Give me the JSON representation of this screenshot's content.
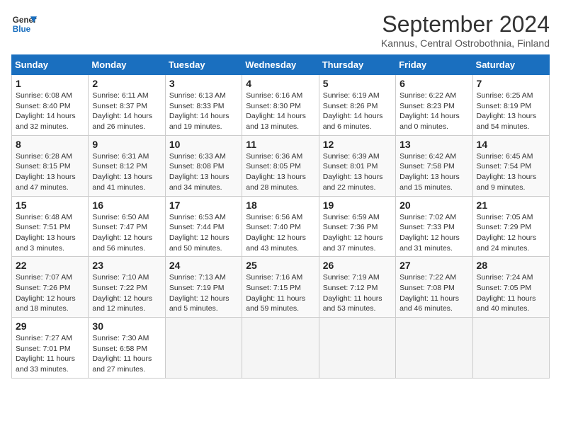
{
  "header": {
    "logo_line1": "General",
    "logo_line2": "Blue",
    "month_title": "September 2024",
    "subtitle": "Kannus, Central Ostrobothnia, Finland"
  },
  "weekdays": [
    "Sunday",
    "Monday",
    "Tuesday",
    "Wednesday",
    "Thursday",
    "Friday",
    "Saturday"
  ],
  "weeks": [
    [
      {
        "day": "1",
        "info": "Sunrise: 6:08 AM\nSunset: 8:40 PM\nDaylight: 14 hours\nand 32 minutes."
      },
      {
        "day": "2",
        "info": "Sunrise: 6:11 AM\nSunset: 8:37 PM\nDaylight: 14 hours\nand 26 minutes."
      },
      {
        "day": "3",
        "info": "Sunrise: 6:13 AM\nSunset: 8:33 PM\nDaylight: 14 hours\nand 19 minutes."
      },
      {
        "day": "4",
        "info": "Sunrise: 6:16 AM\nSunset: 8:30 PM\nDaylight: 14 hours\nand 13 minutes."
      },
      {
        "day": "5",
        "info": "Sunrise: 6:19 AM\nSunset: 8:26 PM\nDaylight: 14 hours\nand 6 minutes."
      },
      {
        "day": "6",
        "info": "Sunrise: 6:22 AM\nSunset: 8:23 PM\nDaylight: 14 hours\nand 0 minutes."
      },
      {
        "day": "7",
        "info": "Sunrise: 6:25 AM\nSunset: 8:19 PM\nDaylight: 13 hours\nand 54 minutes."
      }
    ],
    [
      {
        "day": "8",
        "info": "Sunrise: 6:28 AM\nSunset: 8:15 PM\nDaylight: 13 hours\nand 47 minutes."
      },
      {
        "day": "9",
        "info": "Sunrise: 6:31 AM\nSunset: 8:12 PM\nDaylight: 13 hours\nand 41 minutes."
      },
      {
        "day": "10",
        "info": "Sunrise: 6:33 AM\nSunset: 8:08 PM\nDaylight: 13 hours\nand 34 minutes."
      },
      {
        "day": "11",
        "info": "Sunrise: 6:36 AM\nSunset: 8:05 PM\nDaylight: 13 hours\nand 28 minutes."
      },
      {
        "day": "12",
        "info": "Sunrise: 6:39 AM\nSunset: 8:01 PM\nDaylight: 13 hours\nand 22 minutes."
      },
      {
        "day": "13",
        "info": "Sunrise: 6:42 AM\nSunset: 7:58 PM\nDaylight: 13 hours\nand 15 minutes."
      },
      {
        "day": "14",
        "info": "Sunrise: 6:45 AM\nSunset: 7:54 PM\nDaylight: 13 hours\nand 9 minutes."
      }
    ],
    [
      {
        "day": "15",
        "info": "Sunrise: 6:48 AM\nSunset: 7:51 PM\nDaylight: 13 hours\nand 3 minutes."
      },
      {
        "day": "16",
        "info": "Sunrise: 6:50 AM\nSunset: 7:47 PM\nDaylight: 12 hours\nand 56 minutes."
      },
      {
        "day": "17",
        "info": "Sunrise: 6:53 AM\nSunset: 7:44 PM\nDaylight: 12 hours\nand 50 minutes."
      },
      {
        "day": "18",
        "info": "Sunrise: 6:56 AM\nSunset: 7:40 PM\nDaylight: 12 hours\nand 43 minutes."
      },
      {
        "day": "19",
        "info": "Sunrise: 6:59 AM\nSunset: 7:36 PM\nDaylight: 12 hours\nand 37 minutes."
      },
      {
        "day": "20",
        "info": "Sunrise: 7:02 AM\nSunset: 7:33 PM\nDaylight: 12 hours\nand 31 minutes."
      },
      {
        "day": "21",
        "info": "Sunrise: 7:05 AM\nSunset: 7:29 PM\nDaylight: 12 hours\nand 24 minutes."
      }
    ],
    [
      {
        "day": "22",
        "info": "Sunrise: 7:07 AM\nSunset: 7:26 PM\nDaylight: 12 hours\nand 18 minutes."
      },
      {
        "day": "23",
        "info": "Sunrise: 7:10 AM\nSunset: 7:22 PM\nDaylight: 12 hours\nand 12 minutes."
      },
      {
        "day": "24",
        "info": "Sunrise: 7:13 AM\nSunset: 7:19 PM\nDaylight: 12 hours\nand 5 minutes."
      },
      {
        "day": "25",
        "info": "Sunrise: 7:16 AM\nSunset: 7:15 PM\nDaylight: 11 hours\nand 59 minutes."
      },
      {
        "day": "26",
        "info": "Sunrise: 7:19 AM\nSunset: 7:12 PM\nDaylight: 11 hours\nand 53 minutes."
      },
      {
        "day": "27",
        "info": "Sunrise: 7:22 AM\nSunset: 7:08 PM\nDaylight: 11 hours\nand 46 minutes."
      },
      {
        "day": "28",
        "info": "Sunrise: 7:24 AM\nSunset: 7:05 PM\nDaylight: 11 hours\nand 40 minutes."
      }
    ],
    [
      {
        "day": "29",
        "info": "Sunrise: 7:27 AM\nSunset: 7:01 PM\nDaylight: 11 hours\nand 33 minutes."
      },
      {
        "day": "30",
        "info": "Sunrise: 7:30 AM\nSunset: 6:58 PM\nDaylight: 11 hours\nand 27 minutes."
      },
      {
        "day": "",
        "info": ""
      },
      {
        "day": "",
        "info": ""
      },
      {
        "day": "",
        "info": ""
      },
      {
        "day": "",
        "info": ""
      },
      {
        "day": "",
        "info": ""
      }
    ]
  ]
}
